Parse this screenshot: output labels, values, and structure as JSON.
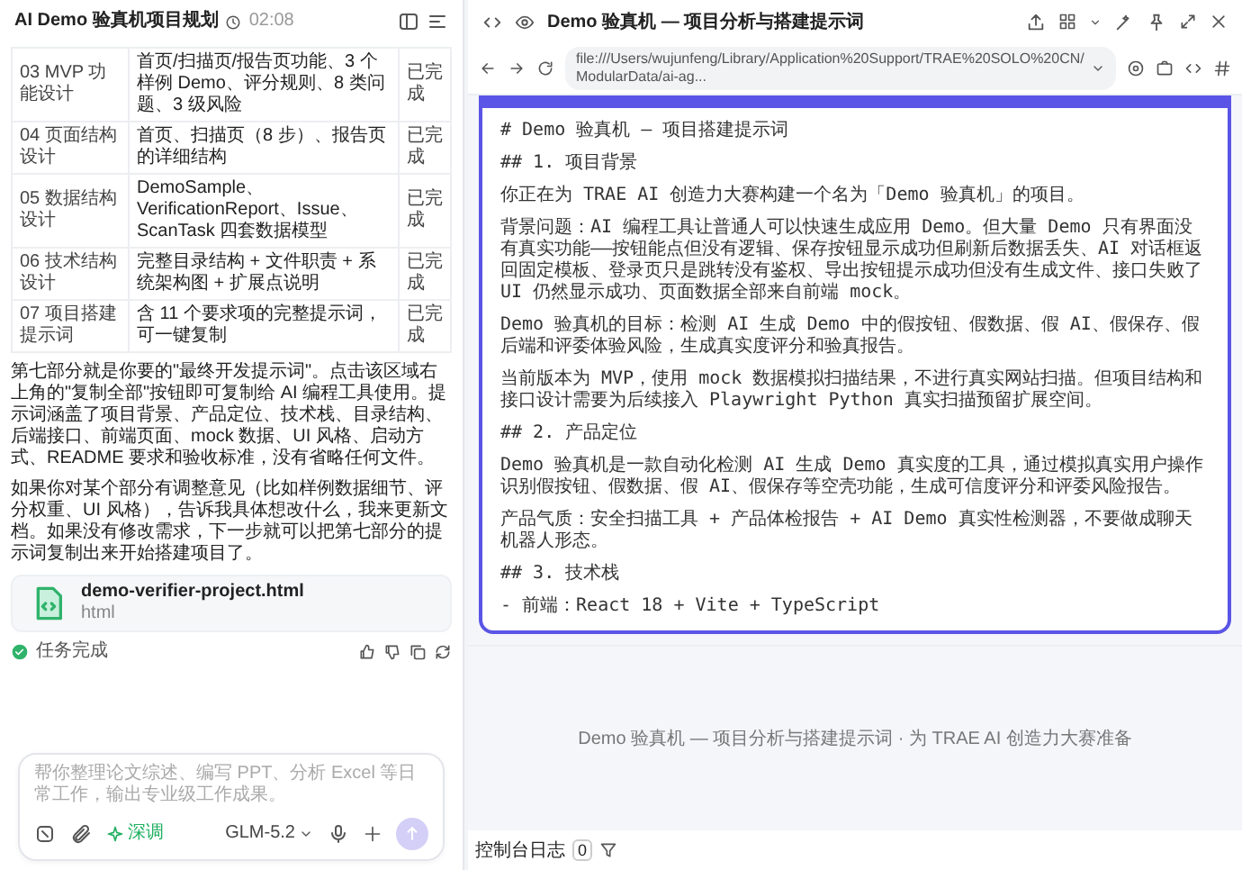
{
  "chat": {
    "title": "AI Demo 验真机项目规划",
    "time": "02:08",
    "table_rows": [
      {
        "module": "03 MVP 功能设计",
        "content": "首页/扫描页/报告页功能、3 个样例 Demo、评分规则、8 类问题、3 级风险",
        "status": "已完成"
      },
      {
        "module": "04 页面结构设计",
        "content": "首页、扫描页（8 步）、报告页的详细结构",
        "status": "已完成"
      },
      {
        "module": "05 数据结构设计",
        "content": "DemoSample、VerificationReport、Issue、ScanTask 四套数据模型",
        "status": "已完成"
      },
      {
        "module": "06 技术结构设计",
        "content": "完整目录结构 + 文件职责 + 系统架构图 + 扩展点说明",
        "status": "已完成"
      },
      {
        "module": "07 项目搭建提示词",
        "content": "含 11 个要求项的完整提示词，可一键复制",
        "status": "已完成"
      }
    ],
    "paragraphs": [
      "第七部分就是你要的\"最终开发提示词\"。点击该区域右上角的\"复制全部\"按钮即可复制给 AI 编程工具使用。提示词涵盖了项目背景、产品定位、技术栈、目录结构、后端接口、前端页面、mock 数据、UI 风格、启动方式、README 要求和验收标准，没有省略任何文件。",
      "如果你对某个部分有调整意见（比如样例数据细节、评分权重、UI 风格），告诉我具体想改什么，我来更新文档。如果没有修改需求，下一步就可以把第七部分的提示词复制出来开始搭建项目了。"
    ],
    "attachment": {
      "name": "demo-verifier-project.html",
      "type": "html"
    },
    "task_status": "任务完成",
    "composer": {
      "placeholder": "帮你整理论文综述、编写 PPT、分析 Excel 等日常工作，输出专业级工作成果。",
      "mode": "深调",
      "model": "GLM-5.2"
    }
  },
  "preview": {
    "title": "Demo 验真机 — 项目分析与搭建提示词",
    "url": "file:///Users/wujunfeng/Library/Application%20Support/TRAE%20SOLO%20CN/ModularData/ai-ag...",
    "code_lines": [
      "# Demo 验真机 — 项目搭建提示词",
      "## 1. 项目背景",
      "你正在为 TRAE AI 创造力大赛构建一个名为「Demo 验真机」的项目。",
      "背景问题：AI 编程工具让普通人可以快速生成应用 Demo。但大量 Demo 只有界面没有真实功能——按钮能点但没有逻辑、保存按钮显示成功但刷新后数据丢失、AI 对话框返回固定模板、登录页只是跳转没有鉴权、导出按钮提示成功但没有生成文件、接口失败了 UI 仍然显示成功、页面数据全部来自前端 mock。",
      "Demo 验真机的目标：检测 AI 生成 Demo 中的假按钮、假数据、假 AI、假保存、假后端和评委体验风险，生成真实度评分和验真报告。",
      "当前版本为 MVP，使用 mock 数据模拟扫描结果，不进行真实网站扫描。但项目结构和接口设计需要为后续接入 Playwright Python 真实扫描预留扩展空间。",
      "## 2. 产品定位",
      "Demo 验真机是一款自动化检测 AI 生成 Demo 真实度的工具，通过模拟真实用户操作识别假按钮、假数据、假 AI、假保存等空壳功能，生成可信度评分和评委风险报告。",
      "产品气质：安全扫描工具 + 产品体检报告 + AI Demo 真实性检测器，不要做成聊天机器人形态。",
      "## 3. 技术栈",
      "- 前端：React 18 + Vite + TypeScript"
    ],
    "footer": "Demo 验真机 — 项目分析与搭建提示词 · 为 TRAE AI 创造力大赛准备",
    "console": {
      "label": "控制台日志",
      "count": "0"
    }
  }
}
